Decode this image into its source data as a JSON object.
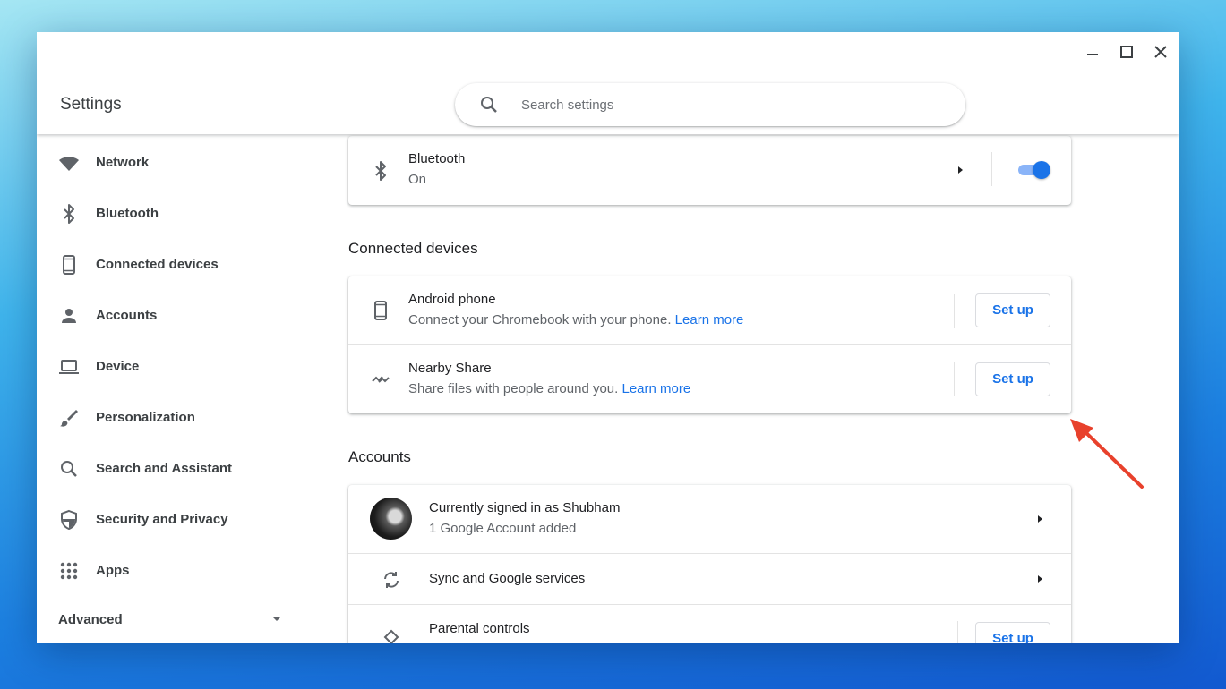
{
  "app": {
    "title": "Settings"
  },
  "search": {
    "placeholder": "Search settings",
    "value": ""
  },
  "sidebar": {
    "items": [
      {
        "label": "Network",
        "icon": "wifi-icon"
      },
      {
        "label": "Bluetooth",
        "icon": "bluetooth-icon"
      },
      {
        "label": "Connected devices",
        "icon": "phone-icon"
      },
      {
        "label": "Accounts",
        "icon": "person-icon"
      },
      {
        "label": "Device",
        "icon": "laptop-icon"
      },
      {
        "label": "Personalization",
        "icon": "brush-icon"
      },
      {
        "label": "Search and Assistant",
        "icon": "search-icon"
      },
      {
        "label": "Security and Privacy",
        "icon": "shield-icon"
      },
      {
        "label": "Apps",
        "icon": "apps-grid-icon"
      }
    ],
    "advanced_label": "Advanced"
  },
  "bluetooth": {
    "title": "Bluetooth",
    "status": "On",
    "enabled": true
  },
  "connected_devices": {
    "heading": "Connected devices",
    "rows": [
      {
        "title": "Android phone",
        "desc": "Connect your Chromebook with your phone.",
        "link": "Learn more",
        "button": "Set up"
      },
      {
        "title": "Nearby Share",
        "desc": "Share files with people around you.",
        "link": "Learn more",
        "button": "Set up"
      }
    ]
  },
  "accounts": {
    "heading": "Accounts",
    "signed_in": {
      "title": "Currently signed in as Shubham",
      "desc": "1 Google Account added"
    },
    "sync": {
      "title": "Sync and Google services"
    },
    "parental": {
      "title": "Parental controls",
      "button": "Set up"
    }
  },
  "colors": {
    "accent": "#1a73e8",
    "annotation": "#e8412c"
  }
}
